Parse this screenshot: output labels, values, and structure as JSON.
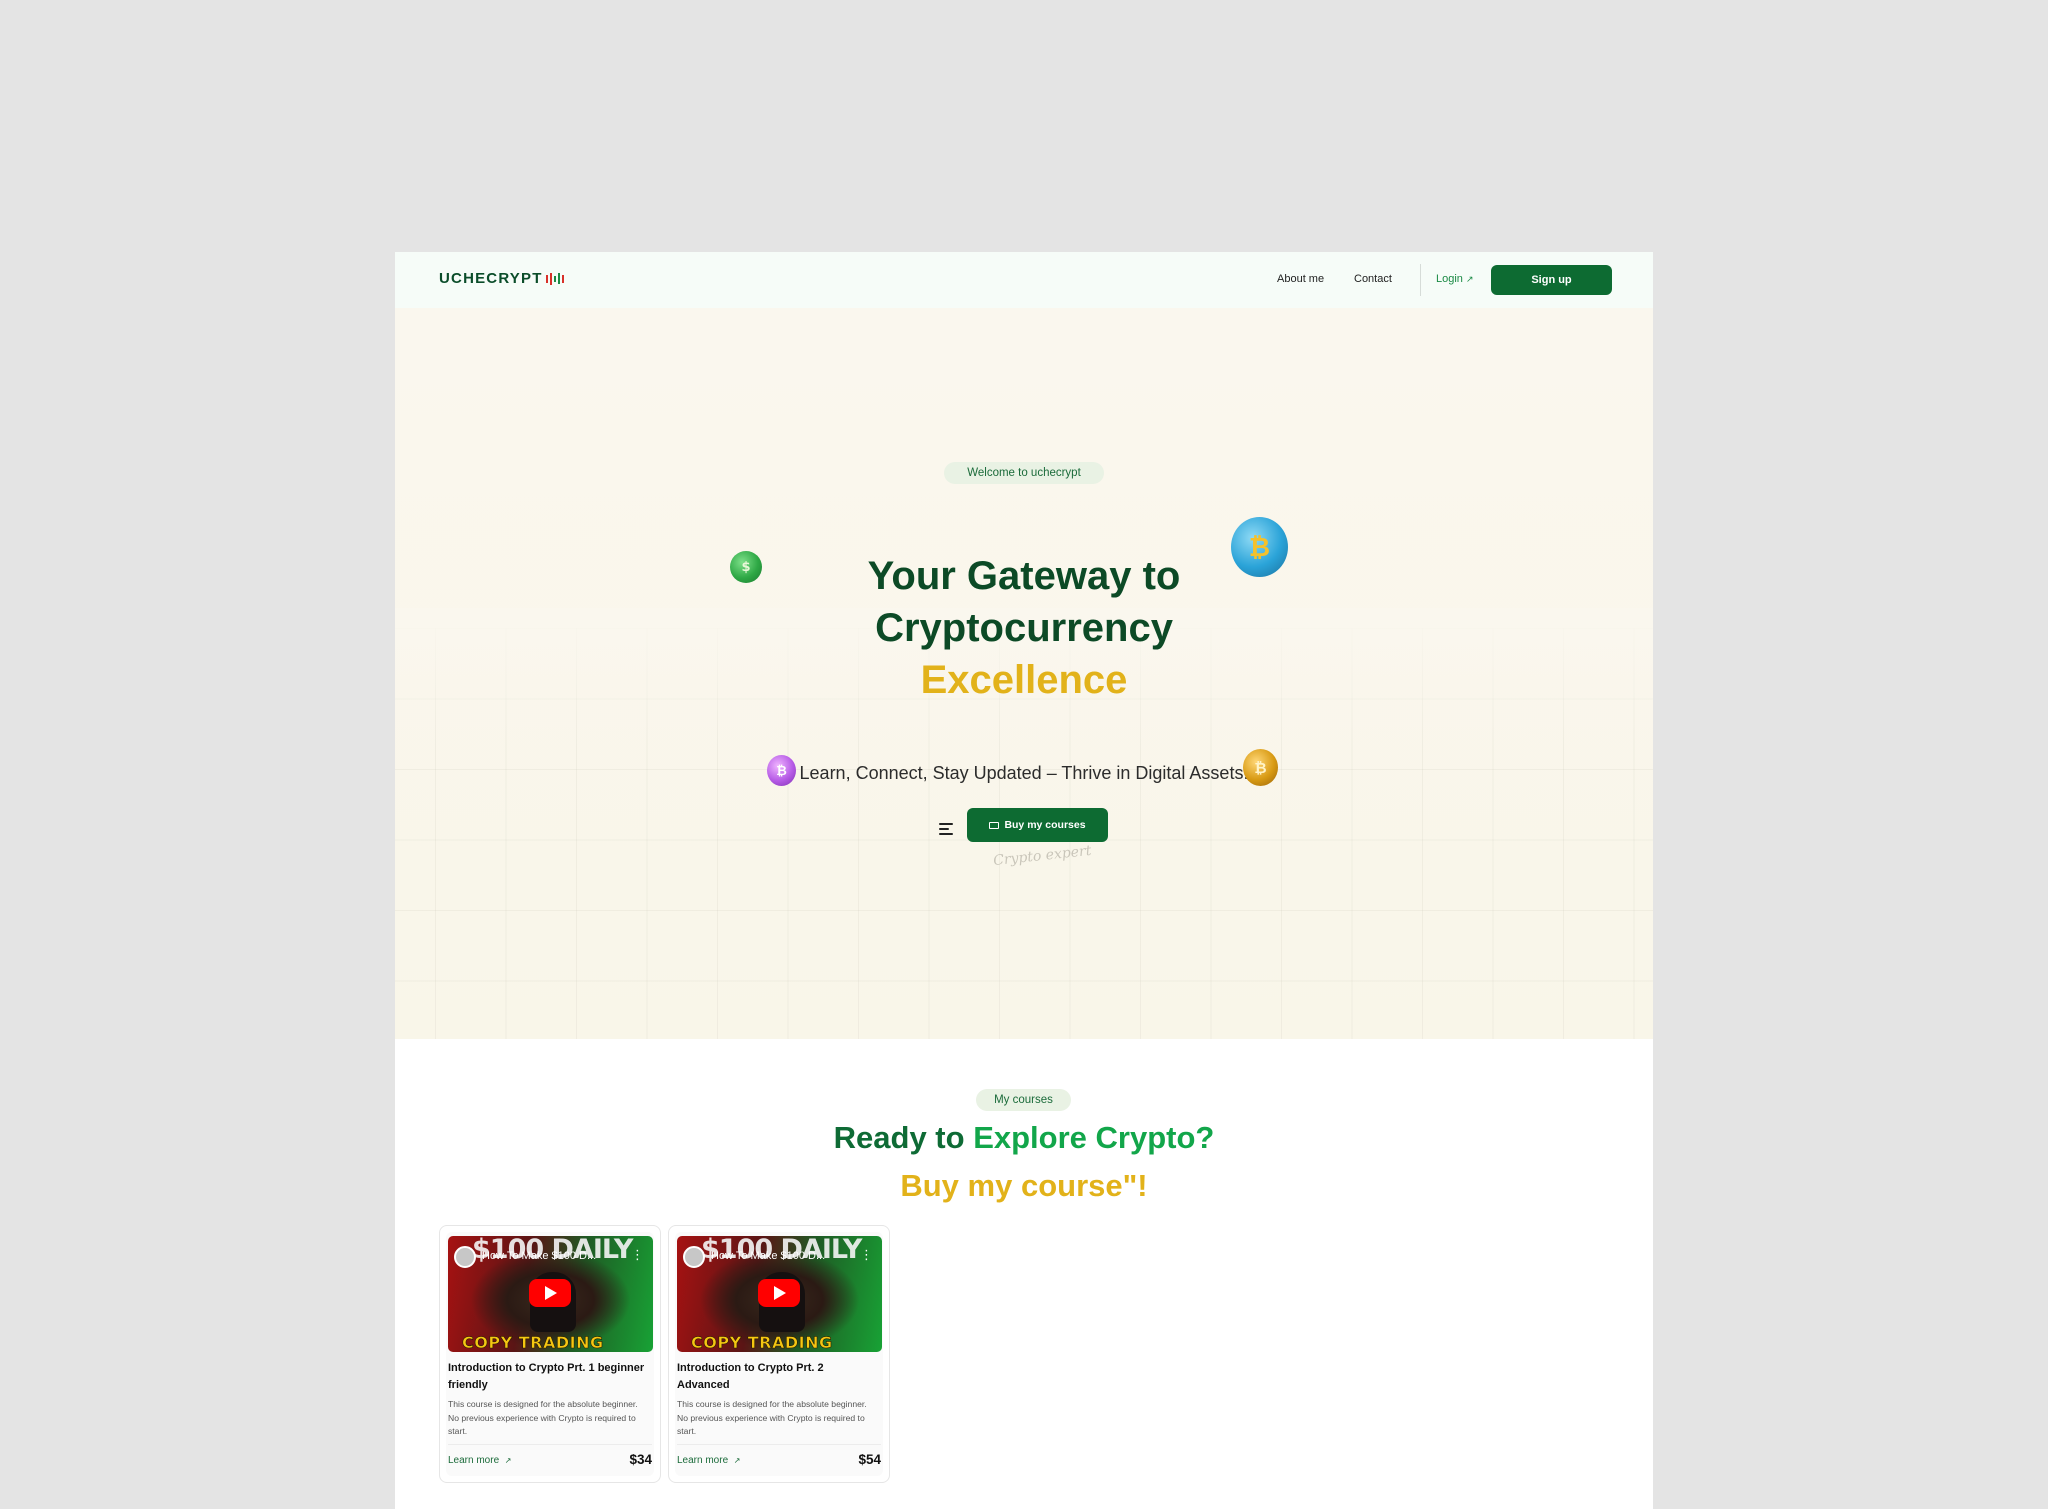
{
  "nav": {
    "logo_text": "UCHECRYPT",
    "links": [
      "About me",
      "Contact"
    ],
    "login_label": "Login",
    "login_arrow": "↗",
    "signup_label": "Sign up"
  },
  "hero": {
    "badge": "Welcome to uchecrypt",
    "title_line1": "Your Gateway to",
    "title_line2": "Cryptocurrency",
    "title_accent": "Excellence",
    "subtitle": "Learn, Connect, Stay Updated – Thrive in Digital Assets.",
    "cta_label": "Buy my courses",
    "signature": "Crypto expert"
  },
  "courses": {
    "badge": "My courses",
    "heading_part1": "Ready to",
    "heading_part2": "Explore Crypto?",
    "heading_line2": "Buy my course\"!",
    "cards": [
      {
        "video_title": "How To Make $100 D...",
        "thumb_headline": "$100 DAILY",
        "thumb_banner": "COPY TRADING",
        "title": "Introduction to Crypto Prt. 1 beginner friendly",
        "description": "This course is designed for the absolute beginner. No previous experience with Crypto is required to start.",
        "link_label": "Learn more",
        "link_arrow": "↗",
        "price": "$34"
      },
      {
        "video_title": "How To Make $100 D...",
        "thumb_headline": "$100 DAILY",
        "thumb_banner": "COPY TRADING",
        "title": "Introduction to Crypto Prt. 2 Advanced",
        "description": "This course is designed for the absolute beginner. No previous experience with Crypto is required to start.",
        "link_label": "Learn more",
        "link_arrow": "↗",
        "price": "$54"
      }
    ]
  },
  "coins": [
    {
      "name": "green-coin",
      "symbol": "$",
      "color": "#2ea845"
    },
    {
      "name": "blue-bitcoin-coin",
      "symbol": "₿",
      "color": "#2aa3d8"
    },
    {
      "name": "purple-coin",
      "symbol": "₿",
      "color": "#b65be6"
    },
    {
      "name": "gold-coin",
      "symbol": "₿",
      "color": "#d89a13"
    }
  ],
  "colors": {
    "brand_dark_green": "#0d6b32",
    "heading_green": "#0c4a26",
    "accent_yellow": "#e2b21a",
    "bright_green": "#12a64a",
    "page_background": "#e4e4e4"
  }
}
